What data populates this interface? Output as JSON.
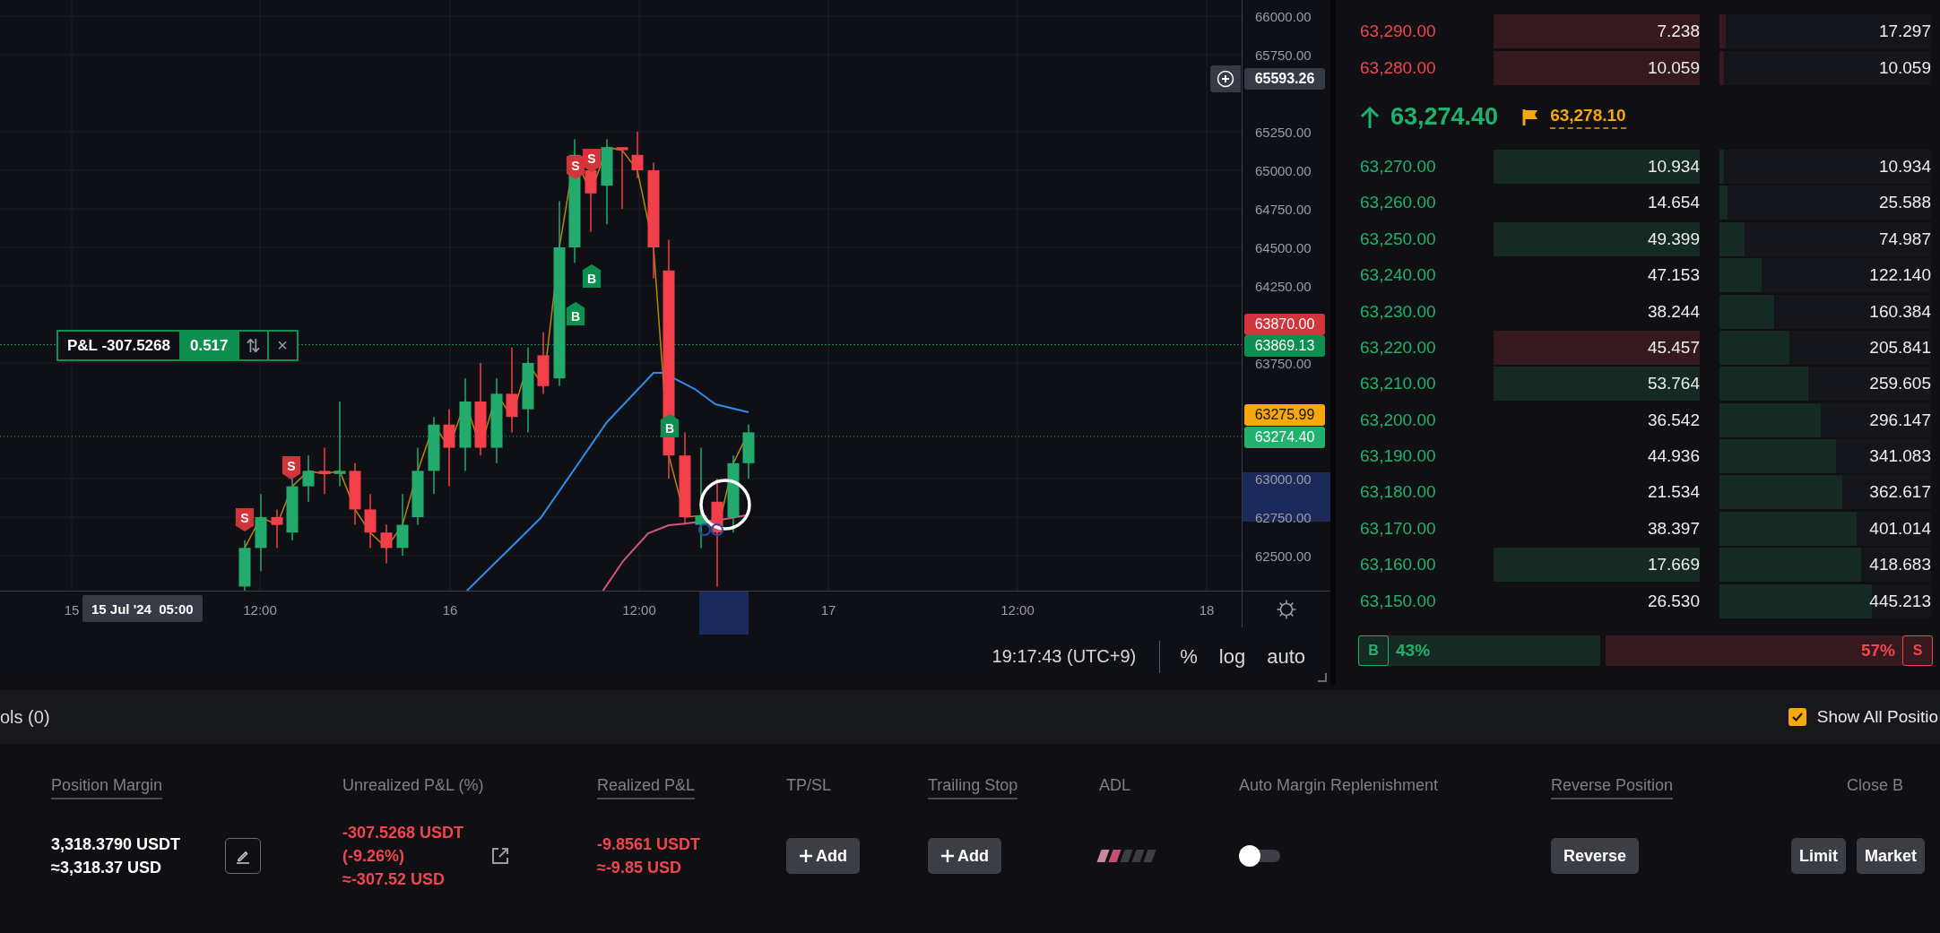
{
  "chart": {
    "price_axis": {
      "ticks": [
        "66000.00",
        "65750.00",
        "65250.00",
        "65000.00",
        "64750.00",
        "64500.00",
        "64250.00",
        "63750.00",
        "63000.00",
        "62750.00",
        "62500.00"
      ]
    },
    "price_tags": [
      {
        "kind": "crosshair",
        "price": "65593.26",
        "color": "#363a45"
      },
      {
        "kind": "price",
        "price": "63870.00",
        "color": "#d1343b"
      },
      {
        "kind": "price",
        "price": "63869.13",
        "color": "#0c8f4f"
      },
      {
        "kind": "price",
        "price": "63275.99",
        "color": "#f5a70c"
      },
      {
        "kind": "price",
        "price": "63274.40",
        "color": "#20b26c"
      }
    ],
    "time_axis": {
      "labels": [
        "15",
        "12:00",
        "16",
        "12:00",
        "17",
        "12:00",
        "18"
      ],
      "crosshair": "15 Jul '24  05:00"
    },
    "trade_markers": [
      {
        "kind": "sell",
        "label": "S"
      },
      {
        "kind": "sell",
        "label": "S"
      },
      {
        "kind": "buy",
        "label": "B"
      },
      {
        "kind": "buy",
        "label": "B"
      },
      {
        "kind": "sell",
        "label": "S"
      },
      {
        "kind": "sell",
        "label": "S"
      },
      {
        "kind": "buy",
        "label": "B"
      }
    ],
    "position_line": {
      "label": "P&L -307.5268",
      "quantity": "0.517",
      "reverse_icon": "⇅",
      "close_icon": "×"
    },
    "footer": {
      "time": "19:17:43 (UTC+9)",
      "scales": [
        {
          "label": "%",
          "selected": false
        },
        {
          "label": "log",
          "selected": false
        },
        {
          "label": "auto",
          "selected": false
        }
      ]
    }
  },
  "order_book": {
    "rows": [
      {
        "kind": "ask",
        "price": "63,290.00",
        "size": "7.238",
        "total": "17.297",
        "color": "#35191f",
        "level": 0.03
      },
      {
        "kind": "ask",
        "price": "63,280.00",
        "size": "10.059",
        "total": "10.059",
        "color": "#35191f",
        "level": 0.02
      },
      {
        "kind": "mid",
        "price": "63,274.40",
        "mark_price": "63,278.10"
      },
      {
        "kind": "bid",
        "price": "63,270.00",
        "size": "10.934",
        "total": "10.934",
        "color": "#152a22",
        "level": 0.02
      },
      {
        "kind": "bid",
        "price": "63,260.00",
        "size": "14.654",
        "total": "25.588",
        "level": 0.04
      },
      {
        "kind": "bid",
        "price": "63,250.00",
        "size": "49.399",
        "total": "74.987",
        "color": "#152a22",
        "level": 0.12
      },
      {
        "kind": "bid",
        "price": "63,240.00",
        "size": "47.153",
        "total": "122.140",
        "level": 0.2
      },
      {
        "kind": "bid",
        "price": "63,230.00",
        "size": "38.244",
        "total": "160.384",
        "level": 0.26
      },
      {
        "kind": "bid",
        "price": "63,220.00",
        "size": "45.457",
        "total": "205.841",
        "color": "#35191f",
        "level": 0.33
      },
      {
        "kind": "bid",
        "price": "63,210.00",
        "size": "53.764",
        "total": "259.605",
        "color": "#152a22",
        "level": 0.42
      },
      {
        "kind": "bid",
        "price": "63,200.00",
        "size": "36.542",
        "total": "296.147",
        "level": 0.48
      },
      {
        "kind": "bid",
        "price": "63,190.00",
        "size": "44.936",
        "total": "341.083",
        "level": 0.55
      },
      {
        "kind": "bid",
        "price": "63,180.00",
        "size": "21.534",
        "total": "362.617",
        "level": 0.58
      },
      {
        "kind": "bid",
        "price": "63,170.00",
        "size": "38.397",
        "total": "401.014",
        "level": 0.65
      },
      {
        "kind": "bid",
        "price": "63,160.00",
        "size": "17.669",
        "total": "418.683",
        "color": "#152a22",
        "level": 0.67
      },
      {
        "kind": "bid",
        "price": "63,150.00",
        "size": "26.530",
        "total": "445.213",
        "level": 0.72
      }
    ],
    "ratio": {
      "buy_badge": "B",
      "buy": "43%",
      "sell": "57%",
      "sell_badge": "S",
      "level": 0.43
    }
  },
  "positions": {
    "tab": "ols (0)",
    "show_all": {
      "label": "Show All Positio",
      "checked": true
    },
    "columns": [
      {
        "label": "Position Margin",
        "underlined": true
      },
      {
        "label": "Unrealized P&L (%)",
        "underlined": false
      },
      {
        "label": "Realized P&L",
        "underlined": true
      },
      {
        "label": "TP/SL",
        "underlined": false
      },
      {
        "label": "Trailing Stop",
        "underlined": true
      },
      {
        "label": "ADL",
        "underlined": false
      },
      {
        "label": "Auto Margin Replenishment",
        "underlined": false
      },
      {
        "label": "Reverse Position",
        "underlined": true
      },
      {
        "label": "Close B",
        "underlined": false
      }
    ],
    "row": {
      "margin": [
        "3,318.3790 USDT",
        "≈3,318.37 USD"
      ],
      "unrealized": [
        "-307.5268 USDT",
        "(-9.26%)",
        "≈-307.52 USD"
      ],
      "realized": [
        "-9.8561 USDT",
        "≈-9.85 USD"
      ],
      "tp_sl": "Add",
      "trailing_stop": "Add",
      "adl": {
        "level": 0.4
      },
      "auto_margin": {
        "on": false
      },
      "reverse": "Reverse",
      "close": [
        "Limit",
        "Market"
      ]
    }
  }
}
